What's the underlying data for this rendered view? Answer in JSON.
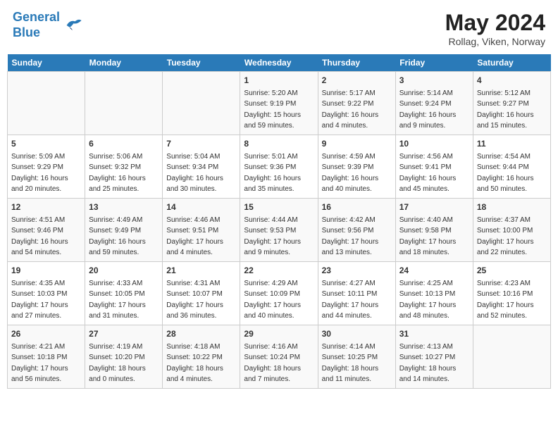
{
  "header": {
    "logo_line1": "General",
    "logo_line2": "Blue",
    "month": "May 2024",
    "location": "Rollag, Viken, Norway"
  },
  "days_of_week": [
    "Sunday",
    "Monday",
    "Tuesday",
    "Wednesday",
    "Thursday",
    "Friday",
    "Saturday"
  ],
  "weeks": [
    [
      {
        "day": null,
        "sunrise": null,
        "sunset": null,
        "daylight": null
      },
      {
        "day": null,
        "sunrise": null,
        "sunset": null,
        "daylight": null
      },
      {
        "day": null,
        "sunrise": null,
        "sunset": null,
        "daylight": null
      },
      {
        "day": "1",
        "sunrise": "Sunrise: 5:20 AM",
        "sunset": "Sunset: 9:19 PM",
        "daylight": "Daylight: 15 hours and 59 minutes."
      },
      {
        "day": "2",
        "sunrise": "Sunrise: 5:17 AM",
        "sunset": "Sunset: 9:22 PM",
        "daylight": "Daylight: 16 hours and 4 minutes."
      },
      {
        "day": "3",
        "sunrise": "Sunrise: 5:14 AM",
        "sunset": "Sunset: 9:24 PM",
        "daylight": "Daylight: 16 hours and 9 minutes."
      },
      {
        "day": "4",
        "sunrise": "Sunrise: 5:12 AM",
        "sunset": "Sunset: 9:27 PM",
        "daylight": "Daylight: 16 hours and 15 minutes."
      }
    ],
    [
      {
        "day": "5",
        "sunrise": "Sunrise: 5:09 AM",
        "sunset": "Sunset: 9:29 PM",
        "daylight": "Daylight: 16 hours and 20 minutes."
      },
      {
        "day": "6",
        "sunrise": "Sunrise: 5:06 AM",
        "sunset": "Sunset: 9:32 PM",
        "daylight": "Daylight: 16 hours and 25 minutes."
      },
      {
        "day": "7",
        "sunrise": "Sunrise: 5:04 AM",
        "sunset": "Sunset: 9:34 PM",
        "daylight": "Daylight: 16 hours and 30 minutes."
      },
      {
        "day": "8",
        "sunrise": "Sunrise: 5:01 AM",
        "sunset": "Sunset: 9:36 PM",
        "daylight": "Daylight: 16 hours and 35 minutes."
      },
      {
        "day": "9",
        "sunrise": "Sunrise: 4:59 AM",
        "sunset": "Sunset: 9:39 PM",
        "daylight": "Daylight: 16 hours and 40 minutes."
      },
      {
        "day": "10",
        "sunrise": "Sunrise: 4:56 AM",
        "sunset": "Sunset: 9:41 PM",
        "daylight": "Daylight: 16 hours and 45 minutes."
      },
      {
        "day": "11",
        "sunrise": "Sunrise: 4:54 AM",
        "sunset": "Sunset: 9:44 PM",
        "daylight": "Daylight: 16 hours and 50 minutes."
      }
    ],
    [
      {
        "day": "12",
        "sunrise": "Sunrise: 4:51 AM",
        "sunset": "Sunset: 9:46 PM",
        "daylight": "Daylight: 16 hours and 54 minutes."
      },
      {
        "day": "13",
        "sunrise": "Sunrise: 4:49 AM",
        "sunset": "Sunset: 9:49 PM",
        "daylight": "Daylight: 16 hours and 59 minutes."
      },
      {
        "day": "14",
        "sunrise": "Sunrise: 4:46 AM",
        "sunset": "Sunset: 9:51 PM",
        "daylight": "Daylight: 17 hours and 4 minutes."
      },
      {
        "day": "15",
        "sunrise": "Sunrise: 4:44 AM",
        "sunset": "Sunset: 9:53 PM",
        "daylight": "Daylight: 17 hours and 9 minutes."
      },
      {
        "day": "16",
        "sunrise": "Sunrise: 4:42 AM",
        "sunset": "Sunset: 9:56 PM",
        "daylight": "Daylight: 17 hours and 13 minutes."
      },
      {
        "day": "17",
        "sunrise": "Sunrise: 4:40 AM",
        "sunset": "Sunset: 9:58 PM",
        "daylight": "Daylight: 17 hours and 18 minutes."
      },
      {
        "day": "18",
        "sunrise": "Sunrise: 4:37 AM",
        "sunset": "Sunset: 10:00 PM",
        "daylight": "Daylight: 17 hours and 22 minutes."
      }
    ],
    [
      {
        "day": "19",
        "sunrise": "Sunrise: 4:35 AM",
        "sunset": "Sunset: 10:03 PM",
        "daylight": "Daylight: 17 hours and 27 minutes."
      },
      {
        "day": "20",
        "sunrise": "Sunrise: 4:33 AM",
        "sunset": "Sunset: 10:05 PM",
        "daylight": "Daylight: 17 hours and 31 minutes."
      },
      {
        "day": "21",
        "sunrise": "Sunrise: 4:31 AM",
        "sunset": "Sunset: 10:07 PM",
        "daylight": "Daylight: 17 hours and 36 minutes."
      },
      {
        "day": "22",
        "sunrise": "Sunrise: 4:29 AM",
        "sunset": "Sunset: 10:09 PM",
        "daylight": "Daylight: 17 hours and 40 minutes."
      },
      {
        "day": "23",
        "sunrise": "Sunrise: 4:27 AM",
        "sunset": "Sunset: 10:11 PM",
        "daylight": "Daylight: 17 hours and 44 minutes."
      },
      {
        "day": "24",
        "sunrise": "Sunrise: 4:25 AM",
        "sunset": "Sunset: 10:13 PM",
        "daylight": "Daylight: 17 hours and 48 minutes."
      },
      {
        "day": "25",
        "sunrise": "Sunrise: 4:23 AM",
        "sunset": "Sunset: 10:16 PM",
        "daylight": "Daylight: 17 hours and 52 minutes."
      }
    ],
    [
      {
        "day": "26",
        "sunrise": "Sunrise: 4:21 AM",
        "sunset": "Sunset: 10:18 PM",
        "daylight": "Daylight: 17 hours and 56 minutes."
      },
      {
        "day": "27",
        "sunrise": "Sunrise: 4:19 AM",
        "sunset": "Sunset: 10:20 PM",
        "daylight": "Daylight: 18 hours and 0 minutes."
      },
      {
        "day": "28",
        "sunrise": "Sunrise: 4:18 AM",
        "sunset": "Sunset: 10:22 PM",
        "daylight": "Daylight: 18 hours and 4 minutes."
      },
      {
        "day": "29",
        "sunrise": "Sunrise: 4:16 AM",
        "sunset": "Sunset: 10:24 PM",
        "daylight": "Daylight: 18 hours and 7 minutes."
      },
      {
        "day": "30",
        "sunrise": "Sunrise: 4:14 AM",
        "sunset": "Sunset: 10:25 PM",
        "daylight": "Daylight: 18 hours and 11 minutes."
      },
      {
        "day": "31",
        "sunrise": "Sunrise: 4:13 AM",
        "sunset": "Sunset: 10:27 PM",
        "daylight": "Daylight: 18 hours and 14 minutes."
      },
      {
        "day": null,
        "sunrise": null,
        "sunset": null,
        "daylight": null
      }
    ]
  ]
}
